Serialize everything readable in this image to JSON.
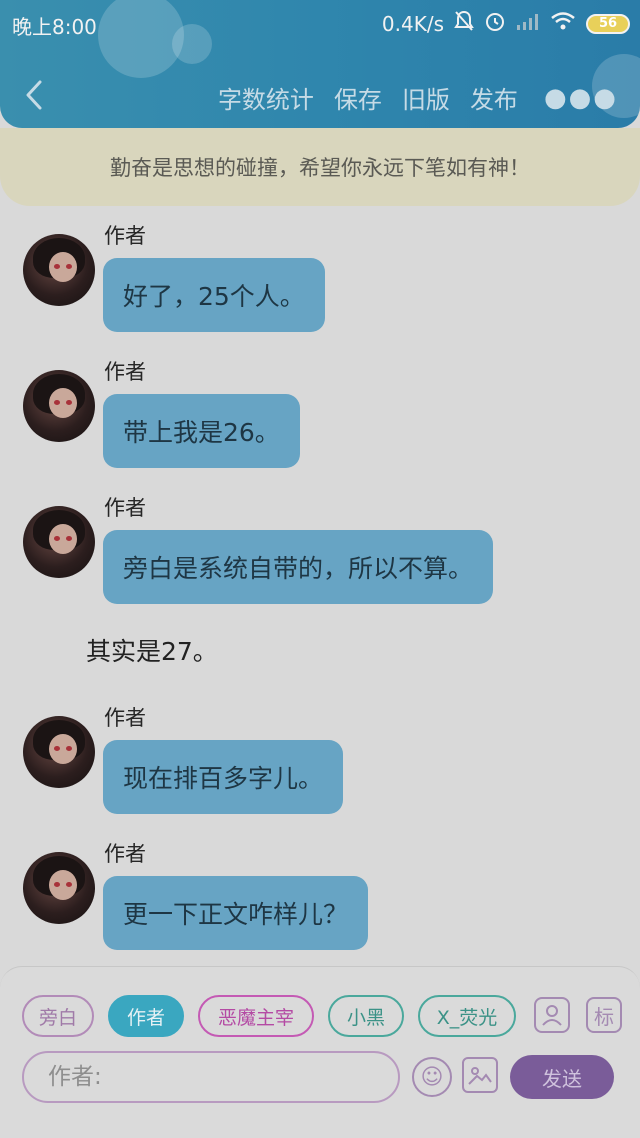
{
  "status": {
    "time": "晚上8:00",
    "net_speed": "0.4K/s",
    "battery": "56"
  },
  "nav": {
    "actions": [
      "字数统计",
      "保存",
      "旧版",
      "发布"
    ]
  },
  "motto": "勤奋是思想的碰撞，希望你永远下笔如有神！",
  "messages": [
    {
      "sender": "作者",
      "text": "好了，25个人。"
    },
    {
      "sender": "作者",
      "text": "带上我是26。"
    },
    {
      "sender": "作者",
      "text": "旁白是系统自带的，所以不算。"
    },
    {
      "sender": "作者",
      "text": "现在排百多字儿。"
    },
    {
      "sender": "作者",
      "text": "更一下正文咋样儿？"
    }
  ],
  "narration": "其实是27。",
  "roles": [
    "旁白",
    "作者",
    "恶魔主宰",
    "小黑",
    "X_荧光"
  ],
  "tag_button": "标",
  "input": {
    "placeholder": "作者:"
  },
  "send_label": "发送",
  "colors": {
    "header": "#2f86ad",
    "motto_bg": "#d9d6bd",
    "bubble": "#67a4c4",
    "send": "#7a5c99"
  }
}
